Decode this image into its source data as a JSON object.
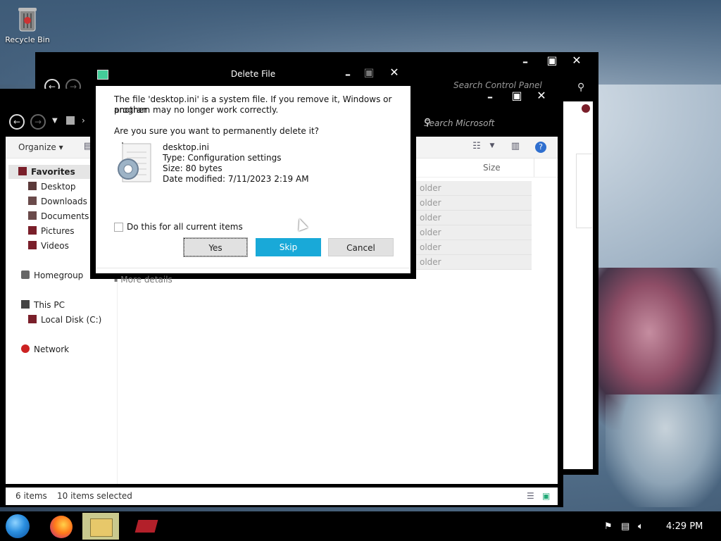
{
  "desktop": {
    "recycle_bin_label": "Recycle Bin"
  },
  "back_window": {
    "search_placeholder": "Search Control Panel",
    "icons": [
      "minimize-icon",
      "maximize-icon",
      "close-icon"
    ]
  },
  "explorer": {
    "search_placeholder": "Search Microsoft",
    "toolbar": {
      "organize_label": "Organize"
    },
    "sidebar": {
      "favorites_label": "Favorites",
      "favorites": [
        {
          "label": "Desktop"
        },
        {
          "label": "Downloads"
        },
        {
          "label": "Documents"
        },
        {
          "label": "Pictures"
        },
        {
          "label": "Videos"
        }
      ],
      "homegroup_label": "Homegroup",
      "this_pc_label": "This PC",
      "local_disk_label": "Local Disk (C:)",
      "network_label": "Network"
    },
    "columns": {
      "size_label": "Size"
    },
    "rows": [
      {
        "type_fragment": "older"
      },
      {
        "type_fragment": "older"
      },
      {
        "type_fragment": "older"
      },
      {
        "type_fragment": "older"
      },
      {
        "type_fragment": "older"
      },
      {
        "type_fragment": "older"
      }
    ],
    "status": {
      "item_count": "6 items",
      "selected_count": "10 items selected"
    }
  },
  "dialog": {
    "title": "Delete File",
    "message_line1": "The file 'desktop.ini' is a system file. If you remove it, Windows or another",
    "message_line2": "program may no longer work correctly.",
    "question": "Are you sure you want to permanently delete it?",
    "file": {
      "name": "desktop.ini",
      "type": "Type: Configuration settings",
      "size": "Size: 80 bytes",
      "date_modified": "Date modified: 7/11/2023 2:19 AM"
    },
    "checkbox_label": "Do this for all current items",
    "buttons": {
      "yes": "Yes",
      "skip": "Skip",
      "cancel": "Cancel"
    },
    "more_details": "More details"
  },
  "taskbar": {
    "clock": "4:29 PM",
    "apps": [
      "start-orb-icon",
      "firefox-icon",
      "file-explorer-icon",
      "app-icon"
    ],
    "tray": [
      "flag-icon",
      "network-icon",
      "volume-icon"
    ]
  },
  "colors": {
    "window_frame": "#000000",
    "accent_button": "#19a9d8",
    "selected_sidebar": "#e5e5e5"
  }
}
